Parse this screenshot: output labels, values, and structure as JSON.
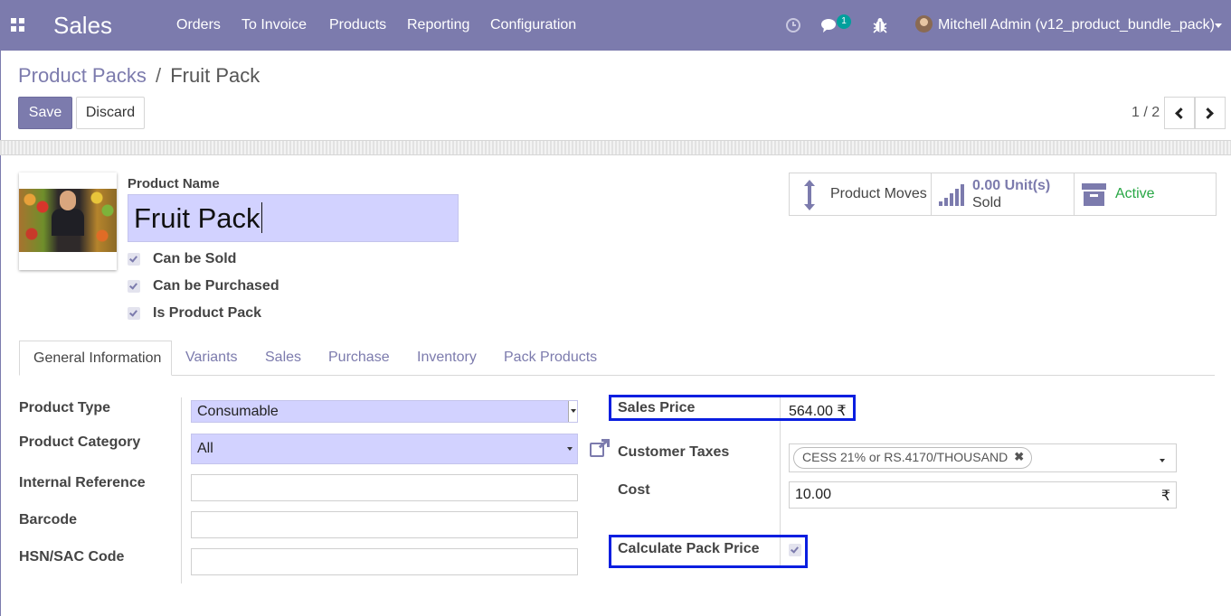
{
  "navbar": {
    "app_name": "Sales",
    "menu": [
      "Orders",
      "To Invoice",
      "Products",
      "Reporting",
      "Configuration"
    ],
    "message_count": "1",
    "user_name": "Mitchell Admin (v12_product_bundle_pack)",
    "icons": [
      "apps-grid-icon",
      "clock-icon",
      "chat-icon",
      "bug-icon"
    ]
  },
  "breadcrumb": {
    "parent": "Product Packs",
    "separator": "/",
    "current": "Fruit Pack"
  },
  "actions": {
    "save": "Save",
    "discard": "Discard"
  },
  "pager": {
    "value": "1 / 2"
  },
  "product": {
    "name_label": "Product Name",
    "name": "Fruit Pack",
    "checkboxes": [
      {
        "label": "Can be Sold",
        "checked": true
      },
      {
        "label": "Can be Purchased",
        "checked": true
      },
      {
        "label": "Is Product Pack",
        "checked": true
      }
    ]
  },
  "smart_buttons": {
    "moves": "Product Moves",
    "sold_value": "0.00 Unit(s)",
    "sold_label": "Sold",
    "active": "Active"
  },
  "tabs": [
    "General Information",
    "Variants",
    "Sales",
    "Purchase",
    "Inventory",
    "Pack Products"
  ],
  "form": {
    "product_type_label": "Product Type",
    "product_type": "Consumable",
    "category_label": "Product Category",
    "category": "All",
    "internal_ref_label": "Internal Reference",
    "internal_ref": "",
    "barcode_label": "Barcode",
    "barcode": "",
    "hsn_label": "HSN/SAC Code",
    "hsn": "",
    "sales_price_label": "Sales Price",
    "sales_price": "564.00 ₹",
    "taxes_label": "Customer Taxes",
    "tax_tag": "CESS 21% or RS.4170/THOUSAND",
    "cost_label": "Cost",
    "cost": "10.00",
    "currency": "₹",
    "calc_pack_label": "Calculate Pack Price",
    "calc_pack_checked": true
  },
  "colors": {
    "primary": "#7c7bad",
    "highlight": "#0a1ee0",
    "active_green": "#28a745",
    "required_bg": "#d2d2ff"
  }
}
